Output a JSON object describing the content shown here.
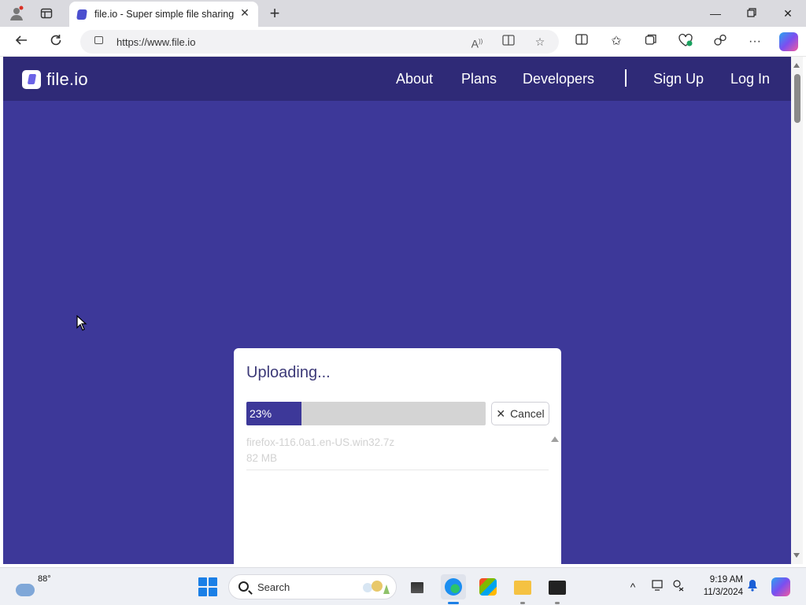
{
  "browser": {
    "tab_title": "file.io - Super simple file sharing",
    "url": "https://www.file.io"
  },
  "site": {
    "logo_text": "file.io",
    "nav": [
      "About",
      "Plans",
      "Developers",
      "Sign Up",
      "Log In"
    ]
  },
  "upload": {
    "title": "Uploading...",
    "progress_label": "23%",
    "progress_fraction": 0.23,
    "cancel_label": "Cancel",
    "file_name": "firefox-116.0a1.en-US.win32.7z",
    "file_size": "82 MB"
  },
  "taskbar": {
    "weather_temp": "88°",
    "search_label": "Search",
    "time": "9:19 AM",
    "date": "11/3/2024"
  },
  "colors": {
    "page_bg": "#3d3899",
    "header_bg": "#2f2a77",
    "accent": "#3d3899"
  }
}
